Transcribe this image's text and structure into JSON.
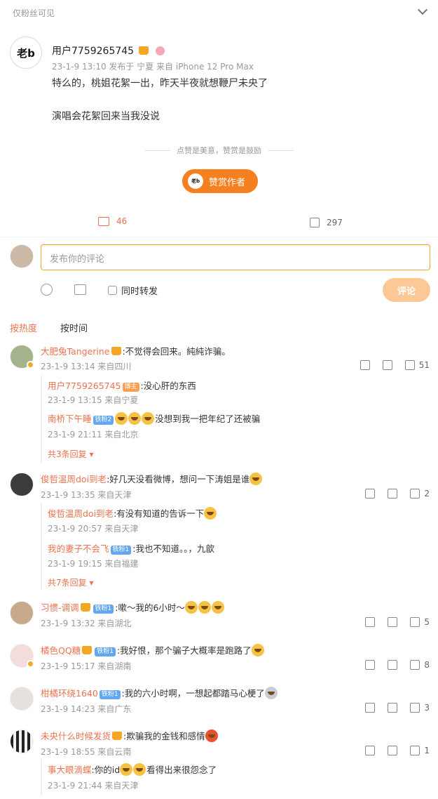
{
  "visibility": "仅粉丝可见",
  "post": {
    "avatar_text": "老b",
    "username": "用户7759265745",
    "meta": "23-1-9 13:10 发布于 宁夏 来自 iPhone 12 Pro Max",
    "line1": "特么的，桃姐花絮一出，昨天半夜就想鞭尸未央了",
    "line2": "演唱会花絮回来当我没说",
    "reward_hint": "点赞是美意，赞赏是鼓励",
    "reward_button": "赞赏作者",
    "comment_count": "46",
    "like_count": "297"
  },
  "composer": {
    "placeholder": "发布你的评论",
    "repost_label": "同时转发",
    "submit_label": "评论"
  },
  "sort_tabs": [
    "按热度",
    "按时间"
  ],
  "comments": [
    {
      "name": "大肥兔Tangerine",
      "text": ":不觉得会回来。純純诈骗。",
      "meta": "23-1-9 13:14 来自四川",
      "likes": "51",
      "replies": [
        {
          "name": "用户7759265745",
          "tag": "博主",
          "text": ":没心肝的东西",
          "meta": "23-1-9 13:15 来自宁夏"
        },
        {
          "name": "南桥下午睡",
          "tag": "铁粉2",
          "text": "没想到我一把年纪了还被骗",
          "meta": "23-1-9 21:11 来自北京"
        }
      ],
      "more": "共3条回复"
    },
    {
      "name": "俊哲温周doi到老",
      "text": ":好几天没看微博，想问一下涛姐是谁",
      "meta": "23-1-9 13:35 来自天津",
      "likes": "2",
      "replies": [
        {
          "name": "俊哲温周doi到老",
          "tag": "",
          "text": ":有没有知道的告诉一下",
          "meta": "23-1-9 20:57 来自天津"
        },
        {
          "name": "我的妻子不会飞",
          "tag": "铁粉1",
          "text": ":我也不知道。。，九歆",
          "meta": "23-1-9 19:15 来自福建"
        }
      ],
      "more": "共7条回复"
    },
    {
      "name": "习惯-调调",
      "tag": "铁粉1",
      "text": ":嗽～我的6小时～",
      "meta": "23-1-9 13:32 来自湖北",
      "likes": "5"
    },
    {
      "name": "橘色QQ糖",
      "tag": "铁粉1",
      "text": ":我好恨，那个骗子大概率是跑路了",
      "meta": "23-1-9 15:17 来自湖南",
      "likes": "8"
    },
    {
      "name": "柑橘环绕1640",
      "tag": "铁粉1",
      "text": ":我的六小时啊，一想起都踏马心梗了",
      "meta": "23-1-9 14:23 来自广东",
      "likes": "3"
    },
    {
      "name": "未央什么时候发货",
      "text": ":欺骗我的金钱和感情",
      "meta": "23-1-9 18:55 来自云南",
      "likes": "1",
      "replies": [
        {
          "name": "事大眼滴蝶",
          "tag": "",
          "text": ":你的id",
          "text2": "看得出来很怨念了",
          "meta": "23-1-9 21:44 来自天津"
        }
      ]
    }
  ]
}
